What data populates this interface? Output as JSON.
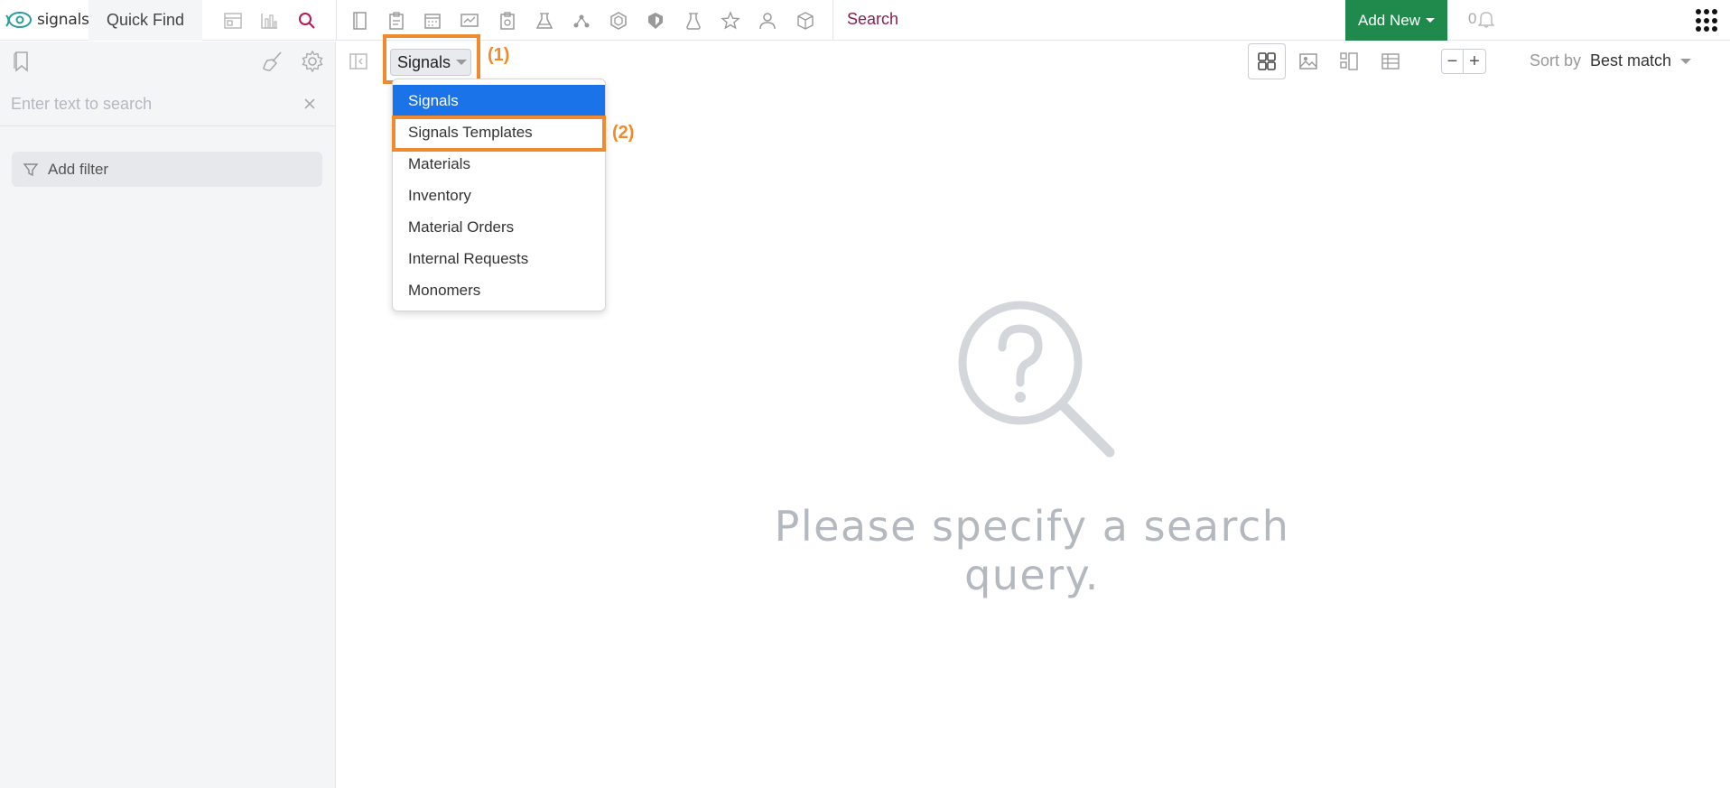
{
  "brand": {
    "name": "signals",
    "accent": "#1f8a4c",
    "link_color": "#8b1d4f",
    "highlight": "#f08a2e"
  },
  "topbar": {
    "quick_find_label": "Quick Find",
    "search_label": "Search",
    "add_new_label": "Add New",
    "notification_count": "0",
    "nav_icons": [
      "dashboard-icon",
      "chart-icon",
      "search-icon",
      "notebook-icon",
      "clipboard-icon",
      "calendar-icon",
      "workflow-icon",
      "request-icon",
      "lab-icon",
      "network-icon",
      "hex-icon",
      "shield-icon",
      "flask-icon",
      "star-icon",
      "users-icon",
      "box-icon"
    ]
  },
  "sidebar": {
    "search_placeholder": "Enter text to search",
    "add_filter_label": "Add filter"
  },
  "toolbar": {
    "entity_selected": "Signals",
    "sort_label": "Sort by",
    "sort_value": "Best match",
    "view_modes": [
      "grid-view",
      "image-view",
      "list-view",
      "table-view"
    ]
  },
  "dropdown": {
    "items": [
      {
        "label": "Signals",
        "selected": true
      },
      {
        "label": "Signals Templates",
        "selected": false
      },
      {
        "label": "Materials",
        "selected": false
      },
      {
        "label": "Inventory",
        "selected": false
      },
      {
        "label": "Material Orders",
        "selected": false
      },
      {
        "label": "Internal Requests",
        "selected": false
      },
      {
        "label": "Monomers",
        "selected": false
      }
    ]
  },
  "annotations": {
    "step1": "(1)",
    "step2": "(2)"
  },
  "empty_state": {
    "message": "Please specify a search query."
  }
}
